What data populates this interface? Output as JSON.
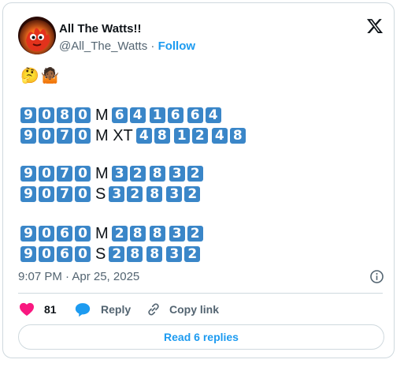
{
  "author": {
    "name": "All The Watts!!",
    "handle": "@All_The_Watts",
    "separator": " · ",
    "follow_label": "Follow"
  },
  "emojis": [
    "🤔",
    "🤷🏾"
  ],
  "tweet_lines": [
    [
      {
        "k": "9080"
      },
      {
        "t": "M"
      },
      {
        "k": "64"
      },
      {
        "k": "16"
      },
      {
        "k": "64"
      }
    ],
    [
      {
        "k": "9070"
      },
      {
        "t": "M XT"
      },
      {
        "k": "48"
      },
      {
        "k": "12"
      },
      {
        "k": "48"
      }
    ],
    [
      {
        "k": "9070"
      },
      {
        "t": "M"
      },
      {
        "k": "32"
      },
      {
        "k": "8"
      },
      {
        "k": "32"
      }
    ],
    [
      {
        "k": "9070"
      },
      {
        "t": "S"
      },
      {
        "k": "32"
      },
      {
        "k": "8"
      },
      {
        "k": "32"
      }
    ],
    [
      {
        "k": "9060"
      },
      {
        "t": "M"
      },
      {
        "k": "28"
      },
      {
        "k": "8"
      },
      {
        "k": "32"
      }
    ],
    [
      {
        "k": "9060"
      },
      {
        "t": "S"
      },
      {
        "k": "28"
      },
      {
        "k": "8"
      },
      {
        "k": "32"
      }
    ]
  ],
  "timestamp": "9:07 PM · Apr 25, 2025",
  "actions": {
    "like_count": "81",
    "reply_label": "Reply",
    "copy_label": "Copy link"
  },
  "read_replies_label": "Read 6 replies",
  "colors": {
    "accent": "#1d9bf0",
    "keycap": "#3a86c8",
    "like": "#f91880",
    "muted": "#536471"
  },
  "icons": [
    "x-logo-icon",
    "info-icon",
    "heart-icon",
    "reply-bubble-icon",
    "link-icon"
  ]
}
